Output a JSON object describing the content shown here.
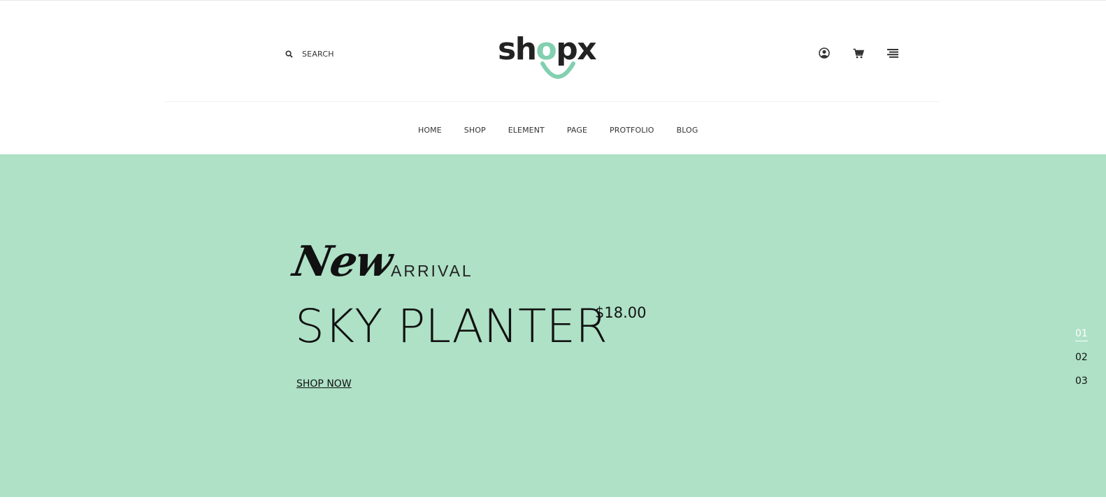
{
  "header": {
    "search_label": "SEARCH",
    "logo_text": {
      "before": "sh",
      "highlight": "o",
      "after": "px"
    }
  },
  "nav": {
    "items": [
      {
        "label": "HOME"
      },
      {
        "label": "SHOP"
      },
      {
        "label": "ELEMENT"
      },
      {
        "label": "PAGE"
      },
      {
        "label": "PROTFOLIO"
      },
      {
        "label": "BLOG"
      }
    ]
  },
  "hero": {
    "script_word": "New",
    "subtitle": "ARRIVAL",
    "title": "SKY PLANTER",
    "price": "$18.00",
    "cta_label": "SHOP NOW",
    "background_color": "#aee1c6"
  },
  "slider": {
    "slides": [
      {
        "label": "01",
        "active": true
      },
      {
        "label": "02",
        "active": false
      },
      {
        "label": "03",
        "active": false
      }
    ]
  },
  "colors": {
    "accent": "#82d0b0",
    "text": "#111111"
  },
  "icons": [
    "search-icon",
    "user-icon",
    "cart-icon",
    "menu-icon"
  ]
}
